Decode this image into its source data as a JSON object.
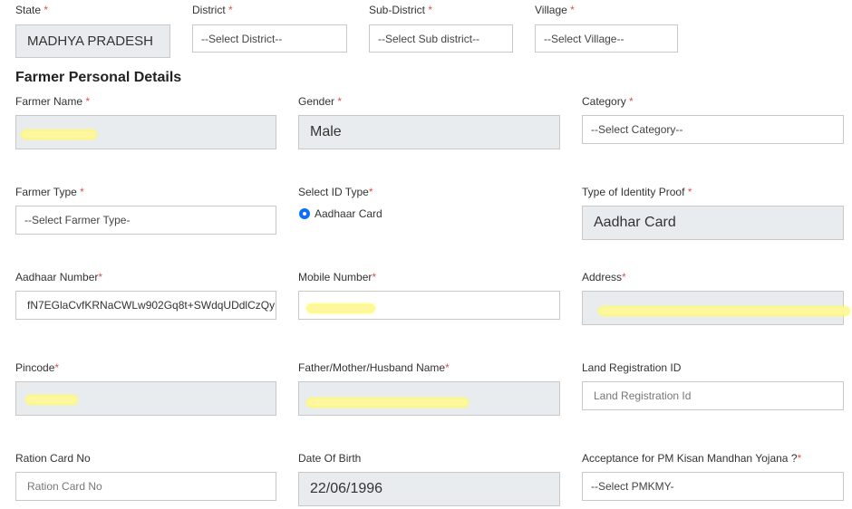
{
  "location": {
    "state": {
      "label": "State",
      "value": "MADHYA PRADESH"
    },
    "district": {
      "label": "District",
      "value": "--Select District--"
    },
    "sub_district": {
      "label": "Sub-District",
      "value": "--Select Sub district--"
    },
    "village": {
      "label": "Village",
      "value": "--Select Village--"
    }
  },
  "section_title": "Farmer Personal Details",
  "required_mark": "*",
  "fields": {
    "farmer_name": {
      "label": "Farmer Name",
      "value": ""
    },
    "gender": {
      "label": "Gender",
      "value": "Male"
    },
    "category": {
      "label": "Category",
      "value": "--Select Category--"
    },
    "farmer_type": {
      "label": "Farmer Type",
      "value": "--Select Farmer Type-"
    },
    "id_type": {
      "label": "Select ID Type",
      "option": "Aadhaar Card"
    },
    "identity_proof": {
      "label": "Type of Identity Proof",
      "value": "Aadhar Card"
    },
    "aadhaar_number": {
      "label": "Aadhaar Number",
      "value": "fN7EGlaCvfKRNaCWLw902Gq8t+SWdqUDdlCzQy"
    },
    "mobile_number": {
      "label": "Mobile Number",
      "value": ""
    },
    "address": {
      "label": "Address",
      "value": ""
    },
    "pincode": {
      "label": "Pincode",
      "value": ""
    },
    "guardian_name": {
      "label": "Father/Mother/Husband Name",
      "value": ""
    },
    "land_registration": {
      "label": "Land Registration ID",
      "placeholder": "Land Registration Id"
    },
    "ration_card": {
      "label": "Ration Card No",
      "placeholder": "Ration Card No"
    },
    "dob": {
      "label": "Date Of Birth",
      "value": "22/06/1996"
    },
    "pmkmy": {
      "label": "Acceptance for PM Kisan Mandhan Yojana ?",
      "value": "--Select PMKMY-"
    }
  },
  "colors": {
    "required": "#d9534f",
    "readonly_bg": "#e9ecef",
    "radio_accent": "#0d6efd",
    "redaction_highlight": "#fff7a0"
  }
}
